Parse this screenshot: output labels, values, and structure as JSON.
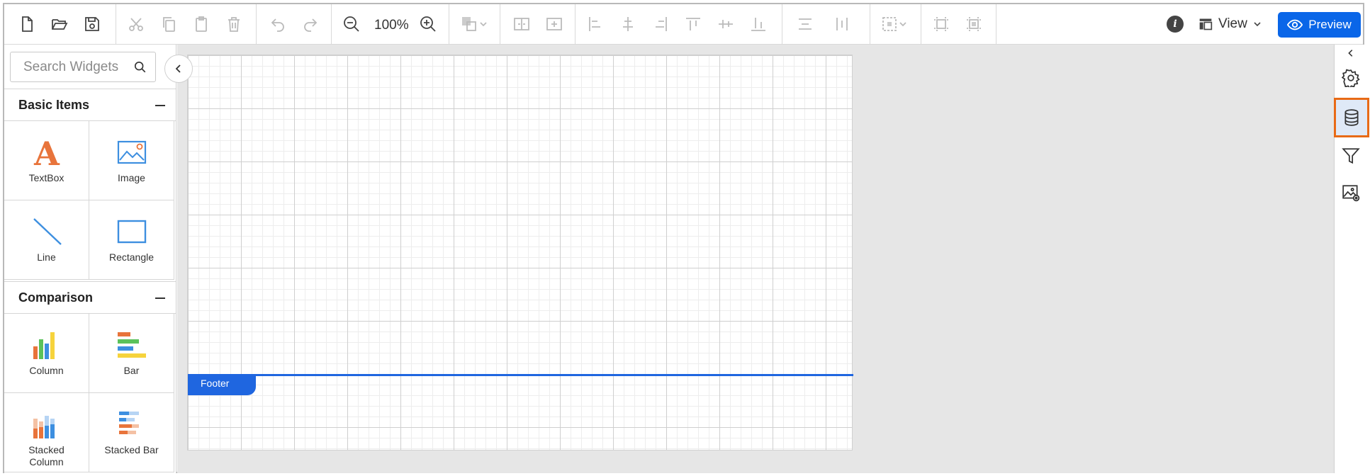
{
  "toolbar": {
    "zoom_level": "100%",
    "view_label": "View",
    "preview_label": "Preview",
    "info_label": "i",
    "icons": [
      "new-file-icon",
      "open-folder-icon",
      "save-icon",
      "cut-icon",
      "copy-icon",
      "paste-icon",
      "delete-icon",
      "undo-icon",
      "redo-icon",
      "zoom-out-icon",
      "zoom-in-icon",
      "order-icon",
      "group-icon",
      "ungroup-icon",
      "align-left-icon",
      "align-center-icon",
      "align-right-icon",
      "align-top-icon",
      "align-middle-icon",
      "align-bottom-icon",
      "distribute-horizontal-icon",
      "distribute-vertical-icon",
      "size-icon",
      "fit-width-icon",
      "fit-height-icon",
      "info-icon",
      "view-layout-icon",
      "eye-icon"
    ]
  },
  "search": {
    "placeholder": "Search Widgets"
  },
  "sections": [
    {
      "title": "Basic Items",
      "items": [
        {
          "label": "TextBox",
          "icon": "textbox-icon"
        },
        {
          "label": "Image",
          "icon": "image-icon"
        },
        {
          "label": "Line",
          "icon": "line-icon"
        },
        {
          "label": "Rectangle",
          "icon": "rectangle-icon"
        }
      ]
    },
    {
      "title": "Comparison",
      "items": [
        {
          "label": "Column",
          "icon": "column-chart-icon"
        },
        {
          "label": "Bar",
          "icon": "bar-chart-icon"
        },
        {
          "label": "Stacked Column",
          "icon": "stacked-column-icon"
        },
        {
          "label": "Stacked Bar",
          "icon": "stacked-bar-icon"
        }
      ]
    }
  ],
  "canvas": {
    "footer_label": "Footer"
  },
  "right_panel": {
    "buttons": [
      "collapse-icon",
      "settings-icon",
      "data-icon",
      "filter-icon",
      "image-manager-icon"
    ],
    "active": "data-icon"
  },
  "colors": {
    "accent": "#0a66e8",
    "highlight_outline": "#e86a16",
    "textbox_orange": "#e8743b",
    "widget_blue": "#3d8fe0",
    "chart_yellow": "#f6d33c",
    "chart_green": "#5bc25b"
  }
}
